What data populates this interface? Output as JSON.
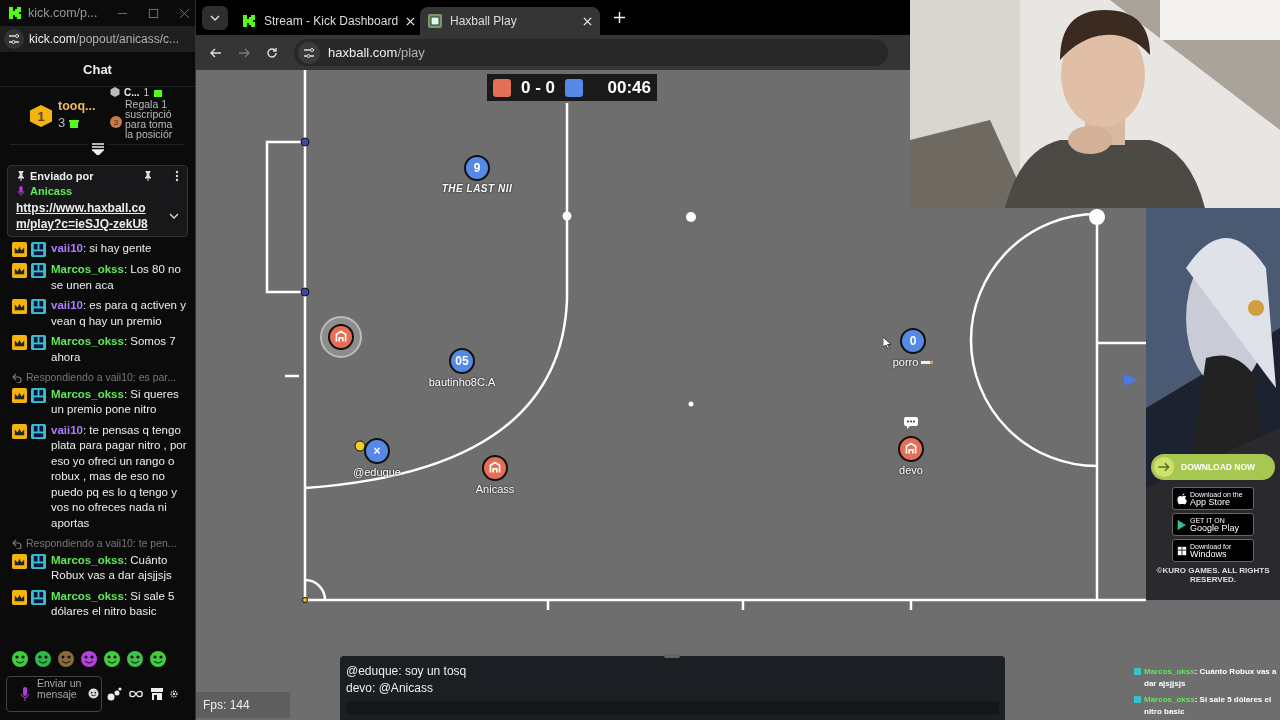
{
  "chat_window": {
    "title": "kick.com/p...",
    "url_host": "kick.com",
    "url_path": "/popout/anicass/c...",
    "header": "Chat",
    "leaderboard": {
      "top_partial": {
        "name": "C...",
        "count": "1"
      },
      "leader": {
        "rank": "1",
        "name": "tooq...",
        "count": "3"
      },
      "third": {
        "rank": "3",
        "text": "Regala 1 suscripció para toma la posiciór"
      }
    },
    "pinned": {
      "label": "Enviado por",
      "author": "Anicass",
      "link": "https://www.haxball.co m/play?c=ieSJQ-zekU8"
    },
    "messages": [
      {
        "kind": "message",
        "user": "vaii10",
        "color": "#b27cff",
        "text": ": si hay gente"
      },
      {
        "kind": "message",
        "user": "Marcos_okss",
        "color": "#5fe85a",
        "text": ": Los 80 no se unen aca"
      },
      {
        "kind": "message",
        "user": "vaii10",
        "color": "#b27cff",
        "text": ": es para q activen y vean q hay un premio"
      },
      {
        "kind": "message",
        "user": "Marcos_okss",
        "color": "#5fe85a",
        "text": ": Somos 7 ahora"
      },
      {
        "kind": "reply",
        "text": "Respondiendo a vaii10: es par..."
      },
      {
        "kind": "message",
        "user": "Marcos_okss",
        "color": "#5fe85a",
        "text": ": Si queres un premio pone nitro"
      },
      {
        "kind": "message",
        "user": "vaii10",
        "color": "#b27cff",
        "text": ": te pensas q tengo plata para pagar nitro , por eso yo ofreci un rango o robux , mas de eso no puedo pq es lo q tengo y vos no ofreces nada ni aportas"
      },
      {
        "kind": "reply",
        "text": "Respondiendo a vaii10: te pen..."
      },
      {
        "kind": "message",
        "user": "Marcos_okss",
        "color": "#5fe85a",
        "text": ": Cuánto Robux vas a dar ajsjjsjs"
      },
      {
        "kind": "message",
        "user": "Marcos_okss",
        "color": "#5fe85a",
        "text": ": Si sale 5 dólares el nitro basic"
      }
    ],
    "input": {
      "placeholder": "Enviar un mensaje"
    }
  },
  "browser": {
    "tabs": [
      {
        "title": "Stream - Kick Dashboard",
        "selected": false
      },
      {
        "title": "Haxball Play",
        "selected": true
      }
    ],
    "url_host": "haxball.com",
    "url_path": "/play"
  },
  "game": {
    "score": "0 - 0",
    "timer": "00:46",
    "players": [
      {
        "color": "#e56e56",
        "kind": "icon",
        "kicking": true,
        "typing": false
      },
      {
        "color": "#5689e5",
        "kind": "text",
        "avatar": "9",
        "name": "THE LAST NII",
        "kicking": false,
        "typing": false
      },
      {
        "color": "#5689e5",
        "kind": "text",
        "avatar": "05",
        "name": "bautinho8C.A",
        "kicking": false,
        "typing": false
      },
      {
        "color": "#5689e5",
        "kind": "text",
        "avatar": "×",
        "name": "@eduque",
        "kicking": false,
        "typing": false
      },
      {
        "color": "#e56e56",
        "kind": "icon",
        "name": "Anicass",
        "kicking": false,
        "typing": false
      },
      {
        "color": "#5689e5",
        "kind": "text",
        "avatar": "0",
        "name": "porro",
        "kicking": false,
        "typing": false
      },
      {
        "color": "#e56e56",
        "kind": "icon",
        "name": "devo",
        "kicking": false,
        "typing": true
      }
    ],
    "chat_lines": [
      "@eduque: soy un tosq",
      "devo: @Anicass"
    ],
    "fps": "Fps: 144"
  },
  "ad": {
    "cta": "DOWNLOAD NOW",
    "stores": [
      {
        "small": "Download on the",
        "big": "App Store"
      },
      {
        "small": "GET IT ON",
        "big": "Google Play"
      },
      {
        "small": "Download for",
        "big": "Windows"
      }
    ],
    "copyright": "©KURO GAMES. ALL RIGHTS RESERVED."
  },
  "overlay_chat": [
    {
      "user": "Marcos_okss",
      "text": ": Cuánto Robux vas a dar ajsjjsjs"
    },
    {
      "user": "Marcos_okss",
      "text": ": Si sale 5 dólares el nitro basic"
    }
  ]
}
